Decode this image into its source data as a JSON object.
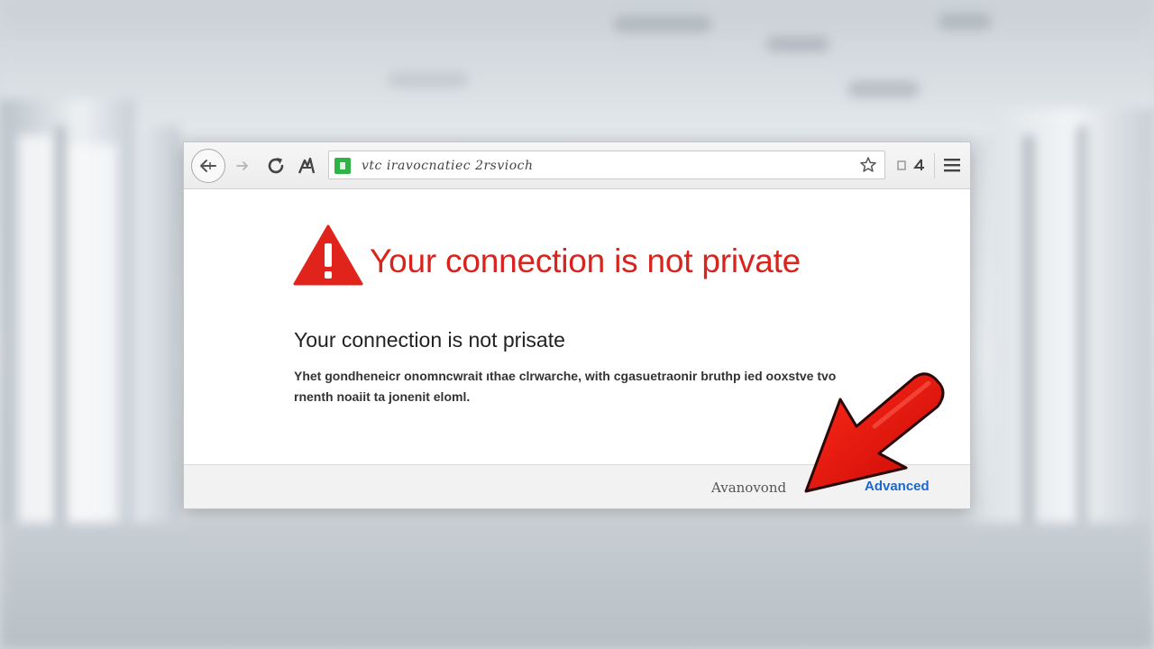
{
  "toolbar": {
    "url": "vtc  iravocnatiec 2rsvioch",
    "colors": {
      "secure_badge": "#2fb344"
    }
  },
  "icons": {
    "back": "back-icon",
    "forward": "forward-icon",
    "reload": "reload-icon",
    "home": "home-icon",
    "lock": "secure-badge-icon",
    "star": "bookmark-star-icon",
    "menu": "hamburger-menu-icon"
  },
  "content": {
    "headline": "Your connection is not private",
    "subhead": "Your connection is not prisate",
    "body": "Yhet gondheneicr onomncwrait ıthae clrwarche, with cgasuetraonir bruthp ied ooxstve tvo rnenth noaiit ta jonenit eloml.",
    "colors": {
      "headline": "#d9231d",
      "warning": "#e0241c",
      "link": "#1a66d2"
    }
  },
  "footer": {
    "back_label": "Avanovond",
    "advanced_label": "Advanced"
  },
  "overlay": {
    "arrow_color": "#e8100c"
  }
}
